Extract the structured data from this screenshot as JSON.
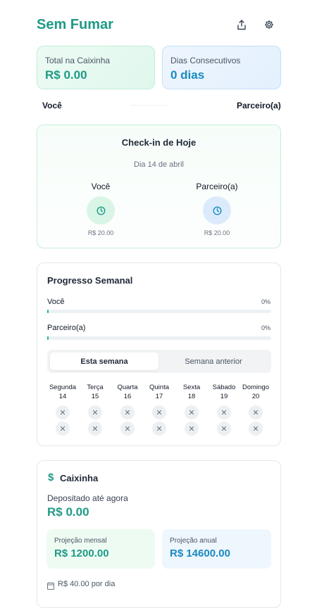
{
  "app": {
    "title": "Sem Fumar"
  },
  "stats": {
    "total_label": "Total na Caixinha",
    "total_value": "R$ 0.00",
    "streak_label": "Dias Consecutivos",
    "streak_value": "0 dias"
  },
  "users": {
    "you": "Você",
    "partner": "Parceiro(a)"
  },
  "checkin": {
    "title": "Check-in de Hoje",
    "day": "Dia 14 de abril",
    "you_label": "Você",
    "you_amount": "R$ 20.00",
    "partner_label": "Parceiro(a)",
    "partner_amount": "R$ 20.00"
  },
  "weekly": {
    "title": "Progresso Semanal",
    "you_label": "Você",
    "you_pct_text": "0%",
    "you_progress": 0,
    "partner_label": "Parceiro(a)",
    "partner_pct_text": "0%",
    "partner_progress": 0,
    "tabs": [
      "Esta semana",
      "Semana anterior"
    ],
    "days": [
      {
        "name": "Segunda",
        "num": "14"
      },
      {
        "name": "Terça",
        "num": "15"
      },
      {
        "name": "Quarta",
        "num": "16"
      },
      {
        "name": "Quinta",
        "num": "17"
      },
      {
        "name": "Sexta",
        "num": "18"
      },
      {
        "name": "Sábado",
        "num": "19"
      },
      {
        "name": "Domingo",
        "num": "20"
      }
    ],
    "mark": "✕"
  },
  "caixinha": {
    "icon_glyph": "$",
    "title": "Caixinha",
    "deposited_label": "Depositado até agora",
    "deposited_value": "R$ 0.00",
    "monthly_label": "Projeção mensal",
    "monthly_value": "R$ 1200.00",
    "annual_label": "Projeção anual",
    "annual_value": "R$ 14600.00",
    "per_day": "R$ 40.00 por dia"
  },
  "colors": {
    "accent": "#1f9a86",
    "blue": "#1a8ac0"
  }
}
